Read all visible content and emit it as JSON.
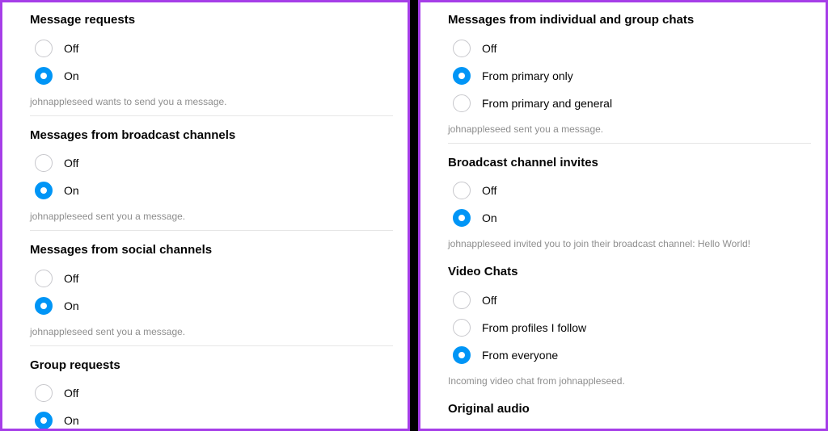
{
  "left": {
    "sections": [
      {
        "title": "Message requests",
        "options": [
          "Off",
          "On"
        ],
        "selected": 1,
        "hint": "johnappleseed wants to send you a message."
      },
      {
        "title": "Messages from broadcast channels",
        "options": [
          "Off",
          "On"
        ],
        "selected": 1,
        "hint": "johnappleseed sent you a message."
      },
      {
        "title": "Messages from social channels",
        "options": [
          "Off",
          "On"
        ],
        "selected": 1,
        "hint": "johnappleseed sent you a message."
      },
      {
        "title": "Group requests",
        "options": [
          "Off",
          "On"
        ],
        "selected": 1,
        "hint": null
      }
    ]
  },
  "right": {
    "sections": [
      {
        "title": "Messages from individual and group chats",
        "options": [
          "Off",
          "From primary only",
          "From primary and general"
        ],
        "selected": 1,
        "hint": "johnappleseed sent you a message."
      },
      {
        "title": "Broadcast channel invites",
        "options": [
          "Off",
          "On"
        ],
        "selected": 1,
        "hint": "johnappleseed invited you to join their broadcast channel: Hello World!",
        "hint_noborder": true
      },
      {
        "title": "Video Chats",
        "options": [
          "Off",
          "From profiles I follow",
          "From everyone"
        ],
        "selected": 2,
        "hint": "Incoming video chat from johnappleseed.",
        "hint_noborder": true
      },
      {
        "title": "Original audio",
        "options": [],
        "selected": -1,
        "hint": null,
        "cutoff": true
      }
    ]
  }
}
